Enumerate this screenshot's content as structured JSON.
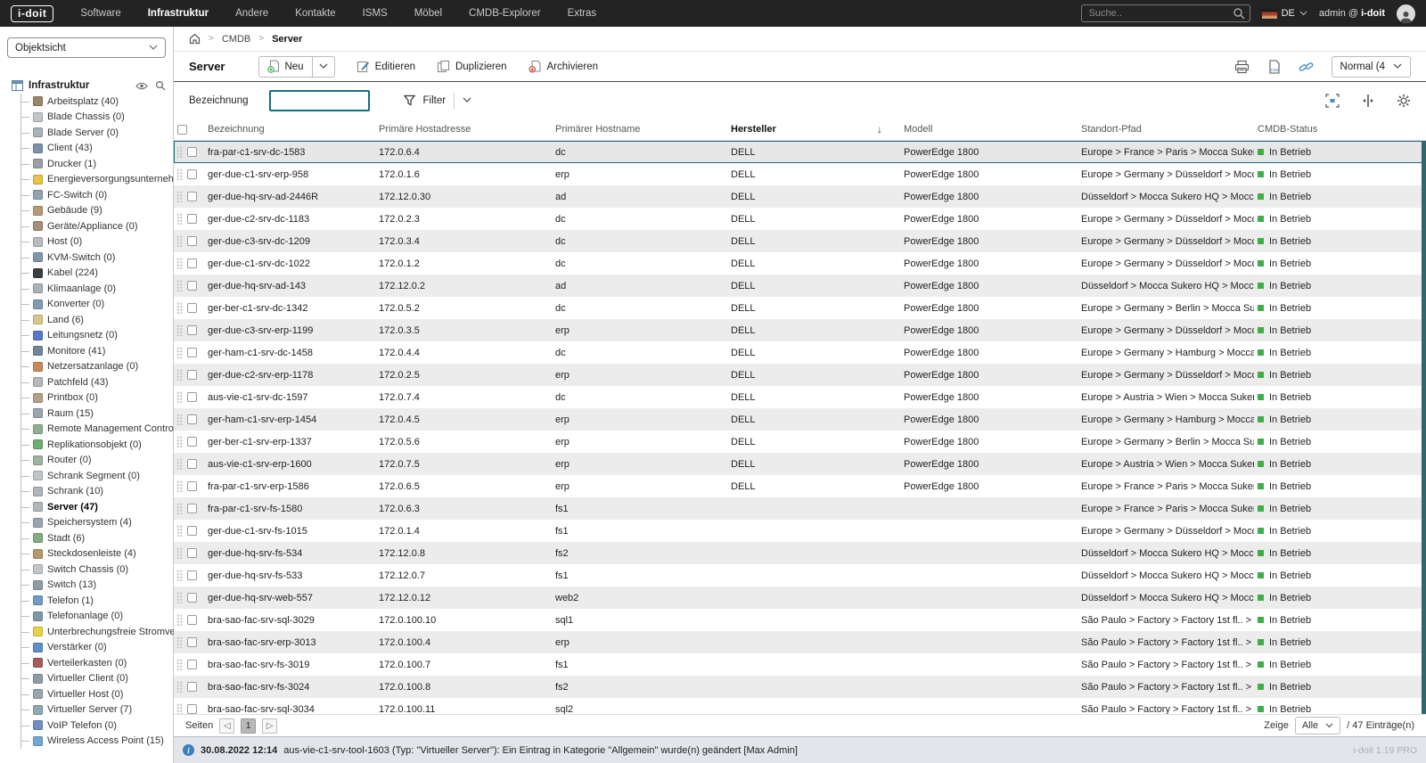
{
  "topnav": {
    "logo": "i-doit",
    "menu": [
      {
        "label": "Software",
        "active": false
      },
      {
        "label": "Infrastruktur",
        "active": true
      },
      {
        "label": "Andere",
        "active": false
      },
      {
        "label": "Kontakte",
        "active": false
      },
      {
        "label": "ISMS",
        "active": false
      },
      {
        "label": "Möbel",
        "active": false
      },
      {
        "label": "CMDB-Explorer",
        "active": false
      },
      {
        "label": "Extras",
        "active": false
      }
    ],
    "search_placeholder": "Suche..",
    "language": "DE",
    "user_prefix": "admin @",
    "user_tenant": "i-doit"
  },
  "breadcrumb": {
    "items": [
      {
        "label": "CMDB"
      },
      {
        "label": "Server"
      }
    ]
  },
  "toolbar": {
    "title": "Server",
    "new_label": "Neu",
    "edit_label": "Editieren",
    "duplicate_label": "Duplizieren",
    "archive_label": "Archivieren",
    "view_mode_label": "Normal (4"
  },
  "filter": {
    "field_label": "Bezeichnung",
    "input_value": "",
    "filter_label": "Filter"
  },
  "sidebar": {
    "view_select": "Objektsicht",
    "tree_root": "Infrastruktur",
    "items": [
      {
        "label": "Arbeitsplatz (40)",
        "icon_color": "#9b8468"
      },
      {
        "label": "Blade Chassis (0)",
        "icon_color": "#c2c6ca"
      },
      {
        "label": "Blade Server (0)",
        "icon_color": "#aab3ba"
      },
      {
        "label": "Client (43)",
        "icon_color": "#7b93a8"
      },
      {
        "label": "Drucker (1)",
        "icon_color": "#9aa0a6"
      },
      {
        "label": "Energieversorgungsunternehm...",
        "icon_color": "#e8c34a"
      },
      {
        "label": "FC-Switch (0)",
        "icon_color": "#8fa3b0"
      },
      {
        "label": "Gebäude (9)",
        "icon_color": "#b59a7a"
      },
      {
        "label": "Geräte/Appliance (0)",
        "icon_color": "#a58f7a"
      },
      {
        "label": "Host (0)",
        "icon_color": "#b8bcc0"
      },
      {
        "label": "KVM-Switch (0)",
        "icon_color": "#7f98a8"
      },
      {
        "label": "Kabel (224)",
        "icon_color": "#3a3f44"
      },
      {
        "label": "Klimaanlage (0)",
        "icon_color": "#aab2b8"
      },
      {
        "label": "Konverter (0)",
        "icon_color": "#7f9bb5"
      },
      {
        "label": "Land (6)",
        "icon_color": "#d8c98a"
      },
      {
        "label": "Leitungsnetz (0)",
        "icon_color": "#5b79c9"
      },
      {
        "label": "Monitore (41)",
        "icon_color": "#6f8797"
      },
      {
        "label": "Netzersatzanlage (0)",
        "icon_color": "#c98a5b"
      },
      {
        "label": "Patchfeld (43)",
        "icon_color": "#b4b9bd"
      },
      {
        "label": "Printbox (0)",
        "icon_color": "#b2a08c"
      },
      {
        "label": "Raum (15)",
        "icon_color": "#9aa5ad"
      },
      {
        "label": "Remote Management Controlle...",
        "icon_color": "#8fb08f"
      },
      {
        "label": "Replikationsobjekt (0)",
        "icon_color": "#6fae6f"
      },
      {
        "label": "Router (0)",
        "icon_color": "#9fb3a0"
      },
      {
        "label": "Schrank Segment (0)",
        "icon_color": "#c0c4c8"
      },
      {
        "label": "Schrank (10)",
        "icon_color": "#aeb6bc"
      },
      {
        "label": "Server (47)",
        "icon_color": "#b0b6ba",
        "active": true
      },
      {
        "label": "Speichersystem (4)",
        "icon_color": "#9aa5ad"
      },
      {
        "label": "Stadt (6)",
        "icon_color": "#7fae7f"
      },
      {
        "label": "Steckdosenleiste (4)",
        "icon_color": "#b89a6a"
      },
      {
        "label": "Switch Chassis (0)",
        "icon_color": "#c3c7cb"
      },
      {
        "label": "Switch (13)",
        "icon_color": "#8f9ba5"
      },
      {
        "label": "Telefon (1)",
        "icon_color": "#6f9bc4"
      },
      {
        "label": "Telefonanlage (0)",
        "icon_color": "#7f98a8"
      },
      {
        "label": "Unterbrechungsfreie Stromver...",
        "icon_color": "#e8d24a"
      },
      {
        "label": "Verstärker (0)",
        "icon_color": "#5b8fc9"
      },
      {
        "label": "Verteilerkasten (0)",
        "icon_color": "#a85b5b"
      },
      {
        "label": "Virtueller Client (0)",
        "icon_color": "#8f9ba5"
      },
      {
        "label": "Virtueller Host (0)",
        "icon_color": "#9aa5ad"
      },
      {
        "label": "Virtueller Server (7)",
        "icon_color": "#8fa8b8"
      },
      {
        "label": "VoIP Telefon (0)",
        "icon_color": "#6f8fc4"
      },
      {
        "label": "Wireless Access Point (15)",
        "icon_color": "#6fa8d4"
      }
    ]
  },
  "table": {
    "columns": [
      {
        "label": "Bezeichnung",
        "sorted": false
      },
      {
        "label": "Primäre Hostadresse",
        "sorted": false
      },
      {
        "label": "Primärer Hostname",
        "sorted": false
      },
      {
        "label": "Hersteller",
        "sorted": true
      },
      {
        "label": "Modell",
        "sorted": false
      },
      {
        "label": "Standort-Pfad",
        "sorted": false
      },
      {
        "label": "CMDB-Status",
        "sorted": false
      }
    ],
    "status_color": "#3fae49",
    "accent_color": "#1d6b7e",
    "rows": [
      {
        "name": "fra-par-c1-srv-dc-1583",
        "ip": "172.0.6.4",
        "host": "dc",
        "vendor": "DELL",
        "model": "PowerEdge 1800",
        "loc": "Europe > France > Paris > Mocca Sukero C.. > f...",
        "status": "In Betrieb",
        "selected": true
      },
      {
        "name": "ger-due-c1-srv-erp-958",
        "ip": "172.0.1.6",
        "host": "erp",
        "vendor": "DELL",
        "model": "PowerEdge 1800",
        "loc": "Europe > Germany > Düsseldorf > Mocca Suke...",
        "status": "In Betrieb"
      },
      {
        "name": "ger-due-hq-srv-ad-2446R",
        "ip": "172.12.0.30",
        "host": "ad",
        "vendor": "DELL",
        "model": "PowerEdge 1800",
        "loc": "Düsseldorf > Mocca Sukero HQ > Mocca Sukero...",
        "status": "In Betrieb"
      },
      {
        "name": "ger-due-c2-srv-dc-1183",
        "ip": "172.0.2.3",
        "host": "dc",
        "vendor": "DELL",
        "model": "PowerEdge 1800",
        "loc": "Europe > Germany > Düsseldorf > Mocca Suke...",
        "status": "In Betrieb"
      },
      {
        "name": "ger-due-c3-srv-dc-1209",
        "ip": "172.0.3.4",
        "host": "dc",
        "vendor": "DELL",
        "model": "PowerEdge 1800",
        "loc": "Europe > Germany > Düsseldorf > Mocca Suke...",
        "status": "In Betrieb"
      },
      {
        "name": "ger-due-c1-srv-dc-1022",
        "ip": "172.0.1.2",
        "host": "dc",
        "vendor": "DELL",
        "model": "PowerEdge 1800",
        "loc": "Europe > Germany > Düsseldorf > Mocca Suke...",
        "status": "In Betrieb"
      },
      {
        "name": "ger-due-hq-srv-ad-143",
        "ip": "172.12.0.2",
        "host": "ad",
        "vendor": "DELL",
        "model": "PowerEdge 1800",
        "loc": "Düsseldorf > Mocca Sukero HQ > Mocca Sukero...",
        "status": "In Betrieb"
      },
      {
        "name": "ger-ber-c1-srv-dc-1342",
        "ip": "172.0.5.2",
        "host": "dc",
        "vendor": "DELL",
        "model": "PowerEdge 1800",
        "loc": "Europe > Germany > Berlin > Mocca Sukero C....",
        "status": "In Betrieb"
      },
      {
        "name": "ger-due-c3-srv-erp-1199",
        "ip": "172.0.3.5",
        "host": "erp",
        "vendor": "DELL",
        "model": "PowerEdge 1800",
        "loc": "Europe > Germany > Düsseldorf > Mocca Suke...",
        "status": "In Betrieb"
      },
      {
        "name": "ger-ham-c1-srv-dc-1458",
        "ip": "172.0.4.4",
        "host": "dc",
        "vendor": "DELL",
        "model": "PowerEdge 1800",
        "loc": "Europe > Germany > Hamburg > Mocca Sukero...",
        "status": "In Betrieb"
      },
      {
        "name": "ger-due-c2-srv-erp-1178",
        "ip": "172.0.2.5",
        "host": "erp",
        "vendor": "DELL",
        "model": "PowerEdge 1800",
        "loc": "Europe > Germany > Düsseldorf > Mocca Suke...",
        "status": "In Betrieb"
      },
      {
        "name": "aus-vie-c1-srv-dc-1597",
        "ip": "172.0.7.4",
        "host": "dc",
        "vendor": "DELL",
        "model": "PowerEdge 1800",
        "loc": "Europe > Austria > Wien > Mocca Sukero C.. > ...",
        "status": "In Betrieb"
      },
      {
        "name": "ger-ham-c1-srv-erp-1454",
        "ip": "172.0.4.5",
        "host": "erp",
        "vendor": "DELL",
        "model": "PowerEdge 1800",
        "loc": "Europe > Germany > Hamburg > Mocca Sukero...",
        "status": "In Betrieb"
      },
      {
        "name": "ger-ber-c1-srv-erp-1337",
        "ip": "172.0.5.6",
        "host": "erp",
        "vendor": "DELL",
        "model": "PowerEdge 1800",
        "loc": "Europe > Germany > Berlin > Mocca Sukero C....",
        "status": "In Betrieb"
      },
      {
        "name": "aus-vie-c1-srv-erp-1600",
        "ip": "172.0.7.5",
        "host": "erp",
        "vendor": "DELL",
        "model": "PowerEdge 1800",
        "loc": "Europe > Austria > Wien > Mocca Sukero C.. > ...",
        "status": "In Betrieb"
      },
      {
        "name": "fra-par-c1-srv-erp-1586",
        "ip": "172.0.6.5",
        "host": "erp",
        "vendor": "DELL",
        "model": "PowerEdge 1800",
        "loc": "Europe > France > Paris > Mocca Sukero C.. > f...",
        "status": "In Betrieb"
      },
      {
        "name": "fra-par-c1-srv-fs-1580",
        "ip": "172.0.6.3",
        "host": "fs1",
        "vendor": "",
        "model": "",
        "loc": "Europe > France > Paris > Mocca Sukero C.. > f...",
        "status": "In Betrieb"
      },
      {
        "name": "ger-due-c1-srv-fs-1015",
        "ip": "172.0.1.4",
        "host": "fs1",
        "vendor": "",
        "model": "",
        "loc": "Europe > Germany > Düsseldorf > Mocca Suke...",
        "status": "In Betrieb"
      },
      {
        "name": "ger-due-hq-srv-fs-534",
        "ip": "172.12.0.8",
        "host": "fs2",
        "vendor": "",
        "model": "",
        "loc": "Düsseldorf > Mocca Sukero HQ > Mocca Sukero...",
        "status": "In Betrieb"
      },
      {
        "name": "ger-due-hq-srv-fs-533",
        "ip": "172.12.0.7",
        "host": "fs1",
        "vendor": "",
        "model": "",
        "loc": "Düsseldorf > Mocca Sukero HQ > Mocca Sukero...",
        "status": "In Betrieb"
      },
      {
        "name": "ger-due-hq-srv-web-557",
        "ip": "172.12.0.12",
        "host": "web2",
        "vendor": "",
        "model": "",
        "loc": "Düsseldorf > Mocca Sukero HQ > Mocca Sukero...",
        "status": "In Betrieb"
      },
      {
        "name": "bra-sao-fac-srv-sql-3029",
        "ip": "172.0.100.10",
        "host": "sql1",
        "vendor": "",
        "model": "",
        "loc": "São Paulo > Factory > Factory 1st fl.. > Factory ...",
        "status": "In Betrieb"
      },
      {
        "name": "bra-sao-fac-srv-erp-3013",
        "ip": "172.0.100.4",
        "host": "erp",
        "vendor": "",
        "model": "",
        "loc": "São Paulo > Factory > Factory 1st fl.. > Factory ...",
        "status": "In Betrieb"
      },
      {
        "name": "bra-sao-fac-srv-fs-3019",
        "ip": "172.0.100.7",
        "host": "fs1",
        "vendor": "",
        "model": "",
        "loc": "São Paulo > Factory > Factory 1st fl.. > Factory ...",
        "status": "In Betrieb"
      },
      {
        "name": "bra-sao-fac-srv-fs-3024",
        "ip": "172.0.100.8",
        "host": "fs2",
        "vendor": "",
        "model": "",
        "loc": "São Paulo > Factory > Factory 1st fl.. > Factory ...",
        "status": "In Betrieb"
      },
      {
        "name": "bra-sao-fac-srv-sql-3034",
        "ip": "172.0.100.11",
        "host": "sql2",
        "vendor": "",
        "model": "",
        "loc": "São Paulo > Factory > Factory 1st fl.. > Factory ...",
        "status": "In Betrieb"
      }
    ]
  },
  "pagination": {
    "pages_label": "Seiten",
    "current_page": "1",
    "show_label": "Zeige",
    "page_size": "Alle",
    "entries_suffix": "/ 47 Einträge(n)"
  },
  "statusbar": {
    "timestamp": "30.08.2022 12:14",
    "message": "aus-vie-c1-srv-tool-1603 (Typ: \"Virtueller Server\"): Ein Eintrag in Kategorie \"Allgemein\" wurde(n) geändert [Max Admin]",
    "version": "i-doit 1.19 PRO"
  }
}
